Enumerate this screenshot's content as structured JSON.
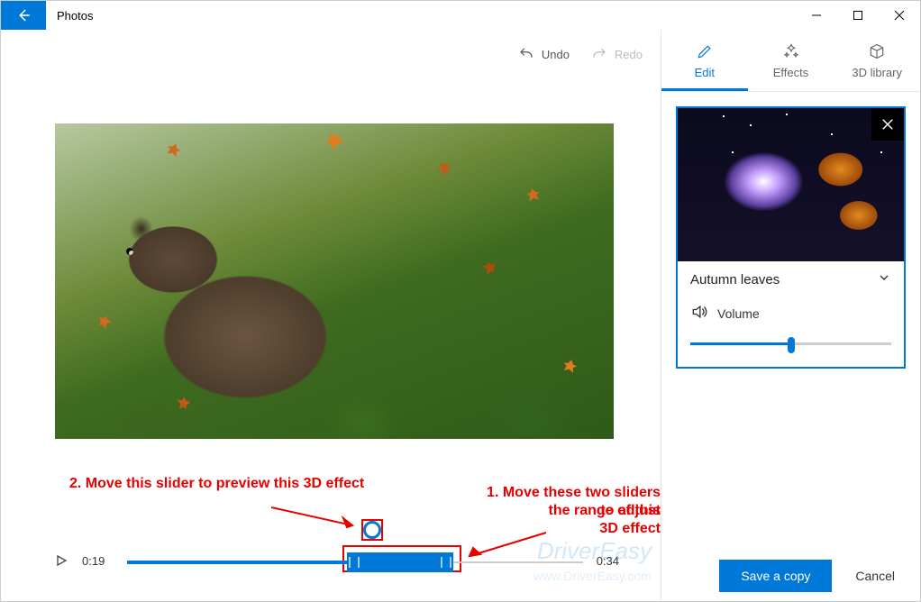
{
  "titlebar": {
    "app_name": "Photos"
  },
  "toolbar": {
    "undo": "Undo",
    "redo": "Redo"
  },
  "timeline": {
    "current_time": "0:19",
    "end_time": "0:34"
  },
  "annotations": {
    "note2": "2. Move this slider to preview this 3D effect",
    "note1_a": "1. Move these two sliders to adjust",
    "note1_b": "the range of this 3D effect"
  },
  "right_pane": {
    "tabs": {
      "edit": "Edit",
      "effects": "Effects",
      "library": "3D library"
    },
    "effect": {
      "title": "Autumn leaves",
      "volume_label": "Volume",
      "volume_percent": 50
    }
  },
  "footer": {
    "save": "Save a copy",
    "cancel": "Cancel"
  },
  "watermark": {
    "brand": "DriverEasy",
    "url": "www.DriverEasy.com"
  }
}
